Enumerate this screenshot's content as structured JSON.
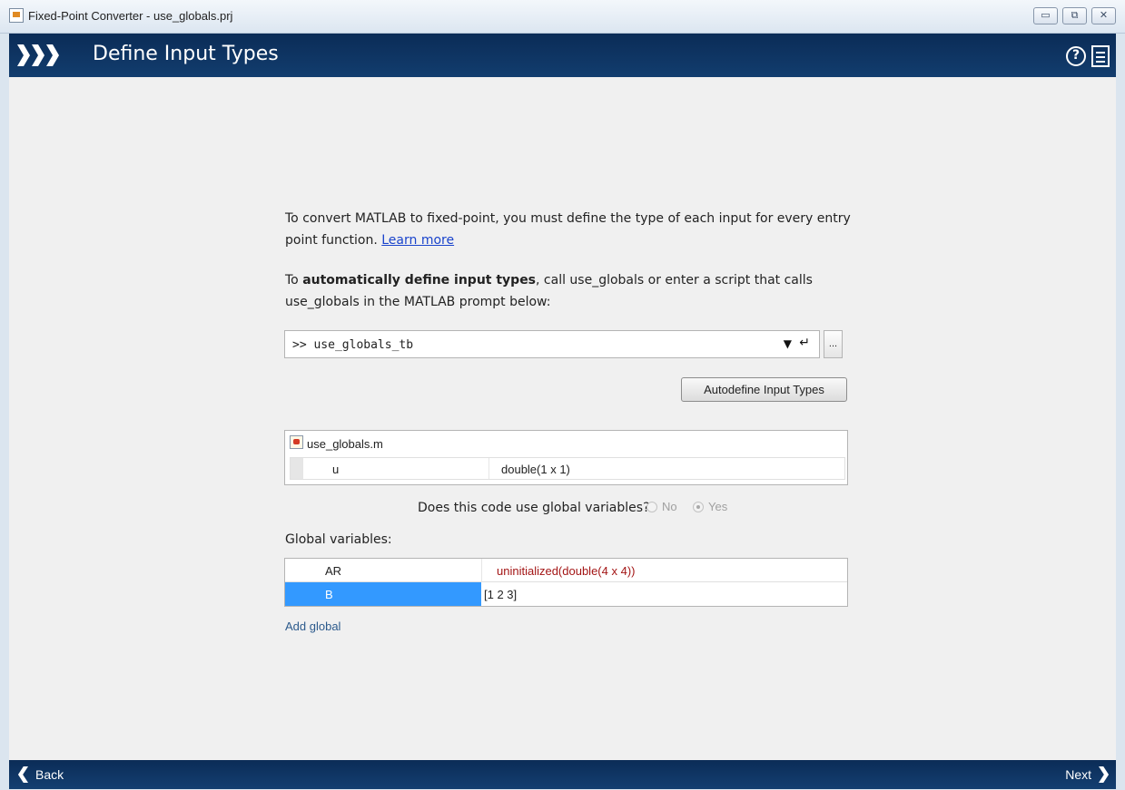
{
  "window": {
    "title": "Fixed-Point Converter - use_globals.prj",
    "controls": {
      "minimize": "▭",
      "restore": "⧉",
      "close": "✕"
    }
  },
  "header": {
    "title": "Define Input Types",
    "help_icon_glyph": "?"
  },
  "intro": {
    "text_before_link": "To convert MATLAB to fixed-point, you must define the type of each input for every entry point function. ",
    "link_text": "Learn more"
  },
  "auto": {
    "prefix": "To ",
    "bold": "automatically define input types",
    "suffix": ", call use_globals or enter a script that calls use_globals in the MATLAB prompt below:"
  },
  "prompt": {
    "value": ">> use_globals_tb",
    "dropdown_glyph": "▼",
    "enter_glyph": "↵",
    "more_label": "..."
  },
  "autodefine_button": "Autodefine Input Types",
  "function_table": {
    "file_name": "use_globals.m",
    "rows": [
      {
        "name": "u",
        "type": "double(1 x 1)"
      }
    ]
  },
  "globals_question": {
    "text": "Does this code use global variables?",
    "options": [
      "No",
      "Yes"
    ],
    "selected": "Yes"
  },
  "globals": {
    "label": "Global variables:",
    "rows": [
      {
        "name": "AR",
        "value": "uninitialized(double(4 x 4))",
        "value_color": "#a31515"
      },
      {
        "name": "B",
        "value": "[1 2 3]",
        "selected": true
      }
    ],
    "add_link": "Add global"
  },
  "footer": {
    "back": "Back",
    "next": "Next"
  },
  "colors": {
    "header_bg": "#0b2c57",
    "selection": "#3399ff",
    "link": "#1a44cc",
    "error_text": "#a31515"
  }
}
